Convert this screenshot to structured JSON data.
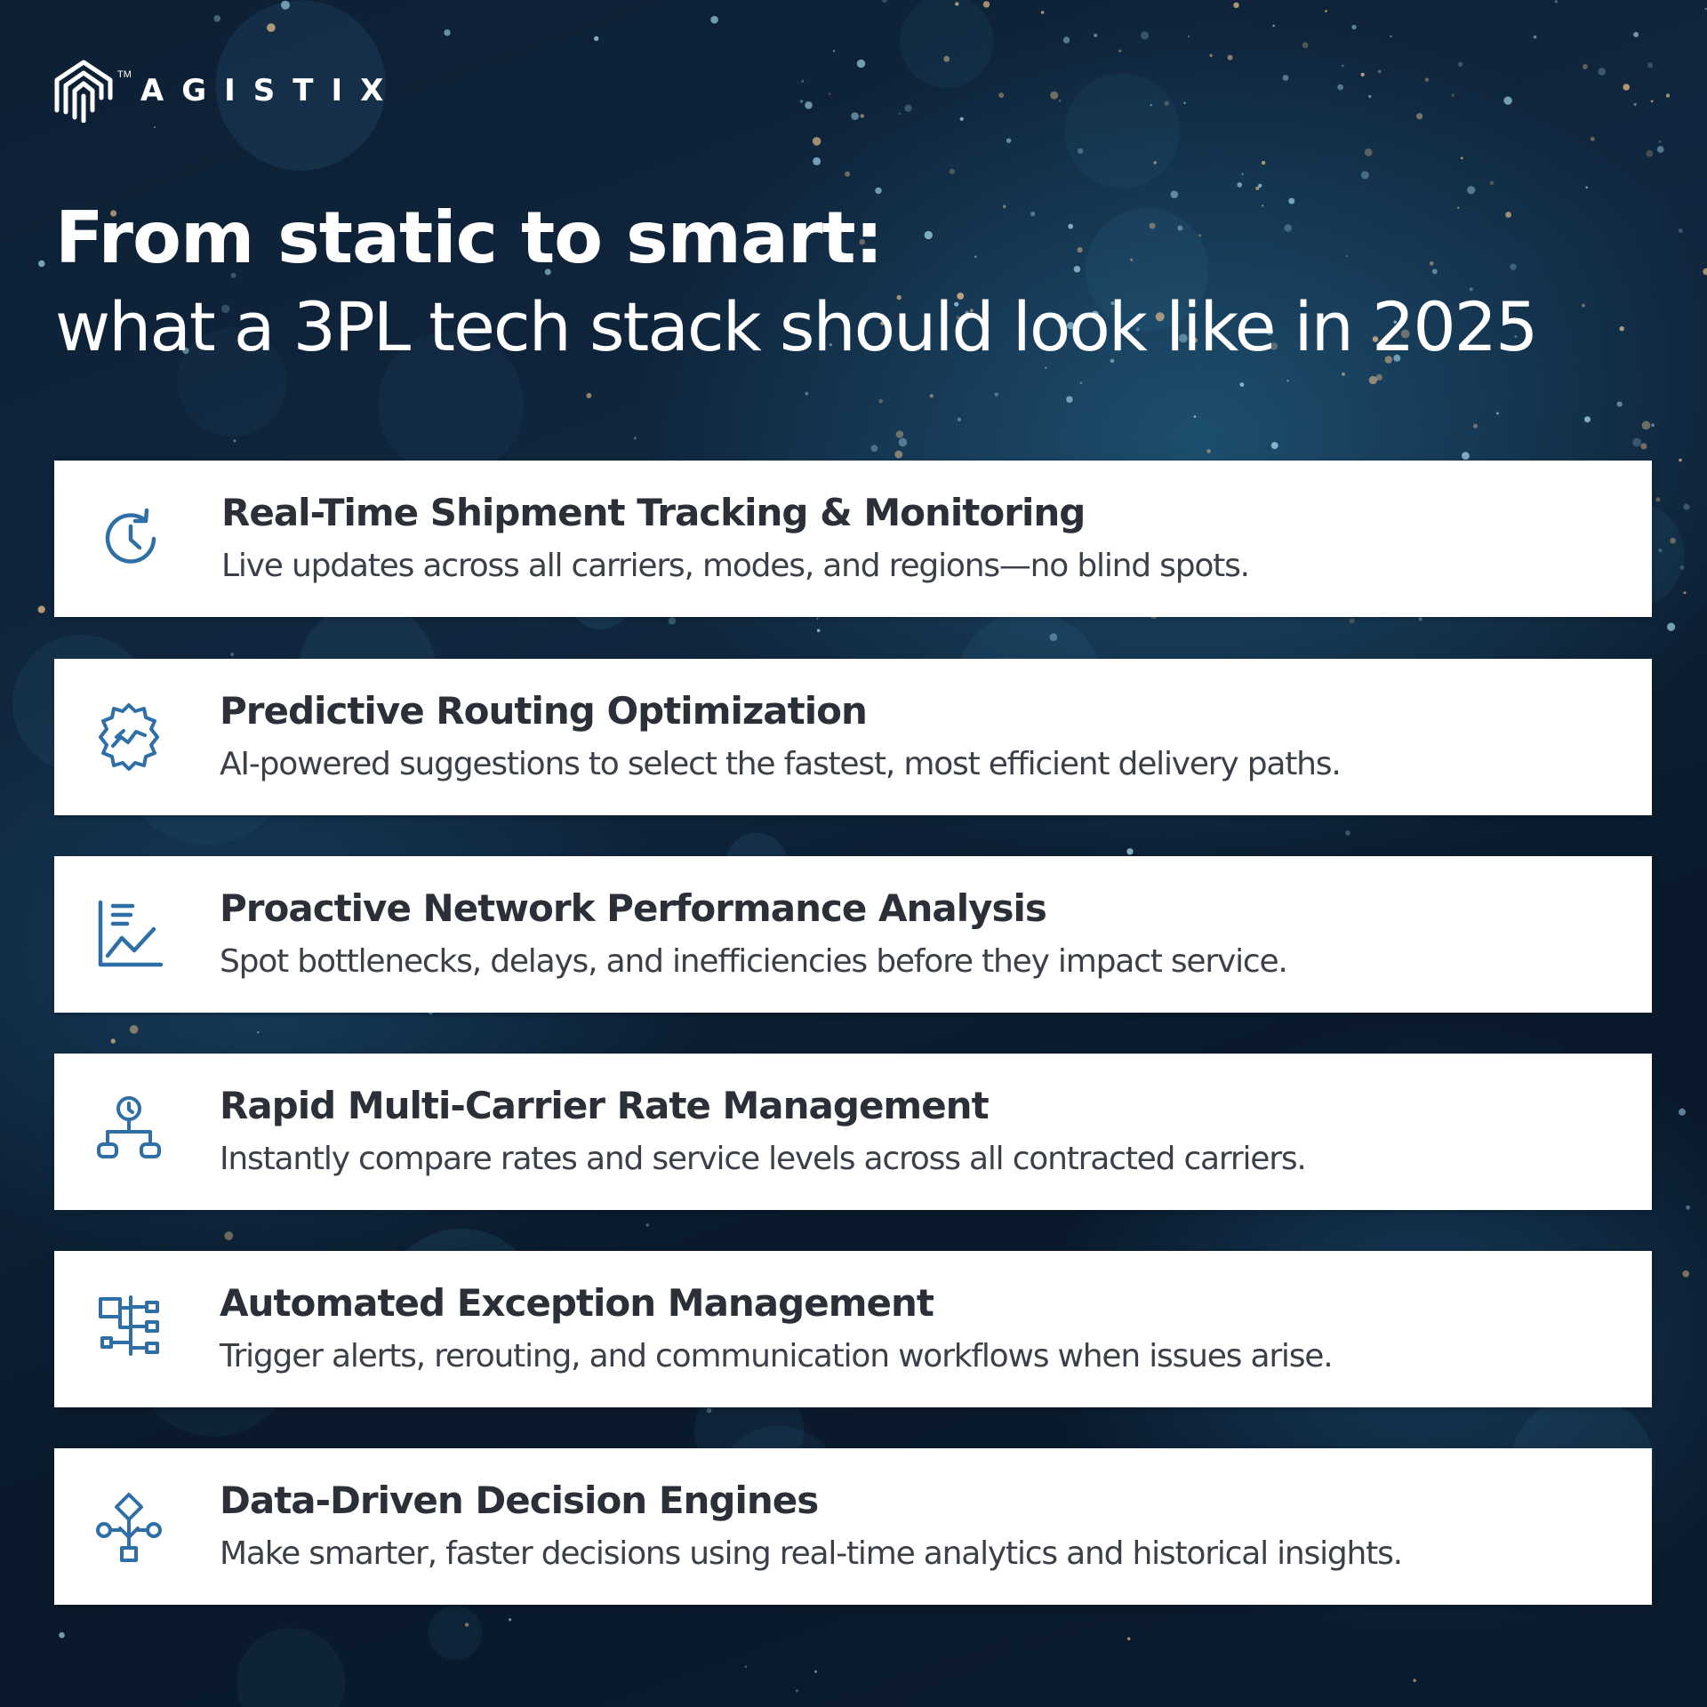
{
  "brand": {
    "name": "AGISTIX",
    "trademark": "TM"
  },
  "headline": {
    "line1": "From static to smart:",
    "line2": "what a 3PL tech stack should look like in 2025"
  },
  "colors": {
    "icon": "#2f6fa8",
    "card_title": "#2b2f38",
    "card_text": "#3a3f48",
    "background": "#0d1f33"
  },
  "features": [
    {
      "icon": "clock-refresh-icon",
      "title": "Real-Time Shipment Tracking & Monitoring",
      "description": "Live updates across all carriers, modes, and regions—no blind spots."
    },
    {
      "icon": "gear-chart-icon",
      "title": "Predictive Routing Optimization",
      "description": "AI-powered suggestions to select the fastest, most efficient delivery paths."
    },
    {
      "icon": "line-chart-icon",
      "title": "Proactive Network Performance Analysis",
      "description": "Spot bottlenecks, delays, and inefficiencies before they impact service."
    },
    {
      "icon": "network-node-icon",
      "title": "Rapid Multi-Carrier Rate Management",
      "description": "Instantly compare rates and service levels across all contracted carriers."
    },
    {
      "icon": "workflow-icon",
      "title": "Automated Exception Management",
      "description": "Trigger alerts, rerouting, and communication workflows when issues arise."
    },
    {
      "icon": "decision-tree-icon",
      "title": "Data-Driven Decision Engines",
      "description": "Make smarter, faster decisions using real-time analytics and historical insights."
    }
  ]
}
